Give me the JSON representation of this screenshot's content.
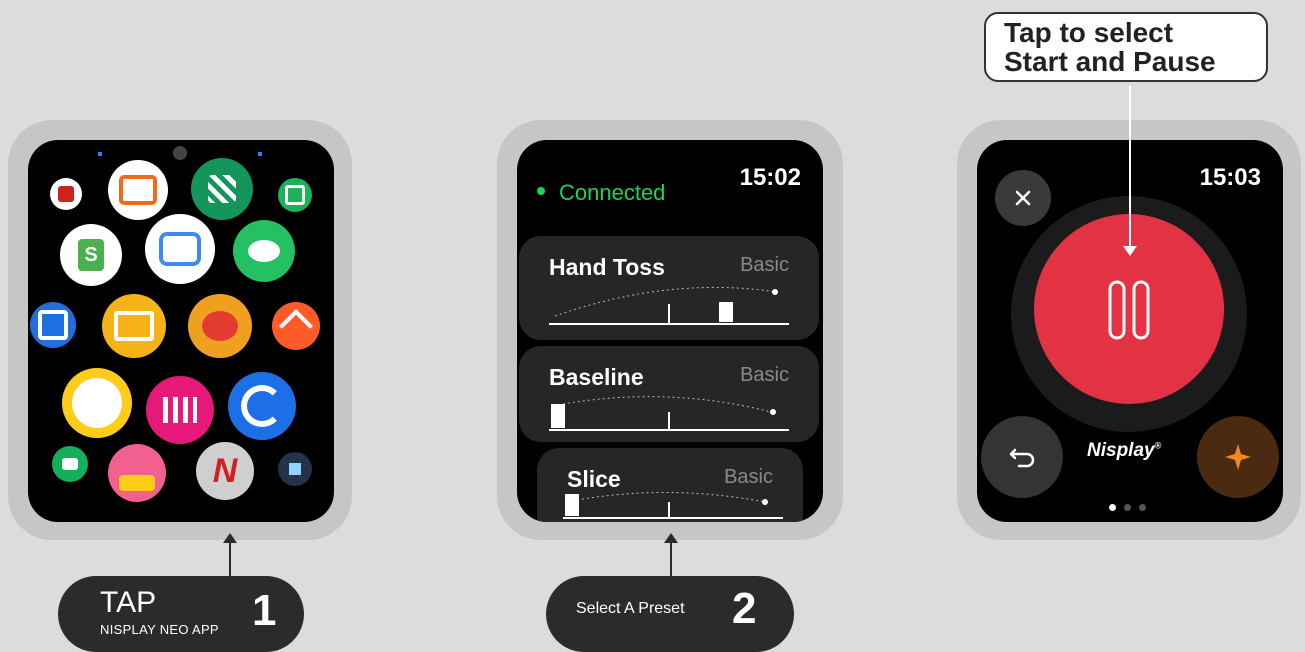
{
  "steps": [
    {
      "title": "TAP",
      "subtitle": "NISPLAY NEO APP",
      "number": "1"
    },
    {
      "title": "Select A Preset",
      "number": "2"
    }
  ],
  "callout": {
    "line1": "Tap to select",
    "line2": "Start and Pause"
  },
  "watch2": {
    "status": "Connected",
    "time": "15:02",
    "presets": [
      {
        "name": "Hand Toss",
        "tag": "Basic"
      },
      {
        "name": "Baseline",
        "tag": "Basic"
      },
      {
        "name": "Slice",
        "tag": "Basic"
      }
    ]
  },
  "watch3": {
    "time": "15:03",
    "brand": "Nisplay",
    "brand_mark": "®",
    "close_icon": "close-icon",
    "pause_icon": "pause-icon",
    "back_icon": "back-arrow-icon",
    "boost_icon": "spark-icon",
    "accent": "#e23244",
    "pages": 3,
    "active_page": 1
  },
  "colors": {
    "connected": "#1fd15b",
    "pill": "#2b2b2b",
    "bezel": "#c6c6c6"
  }
}
